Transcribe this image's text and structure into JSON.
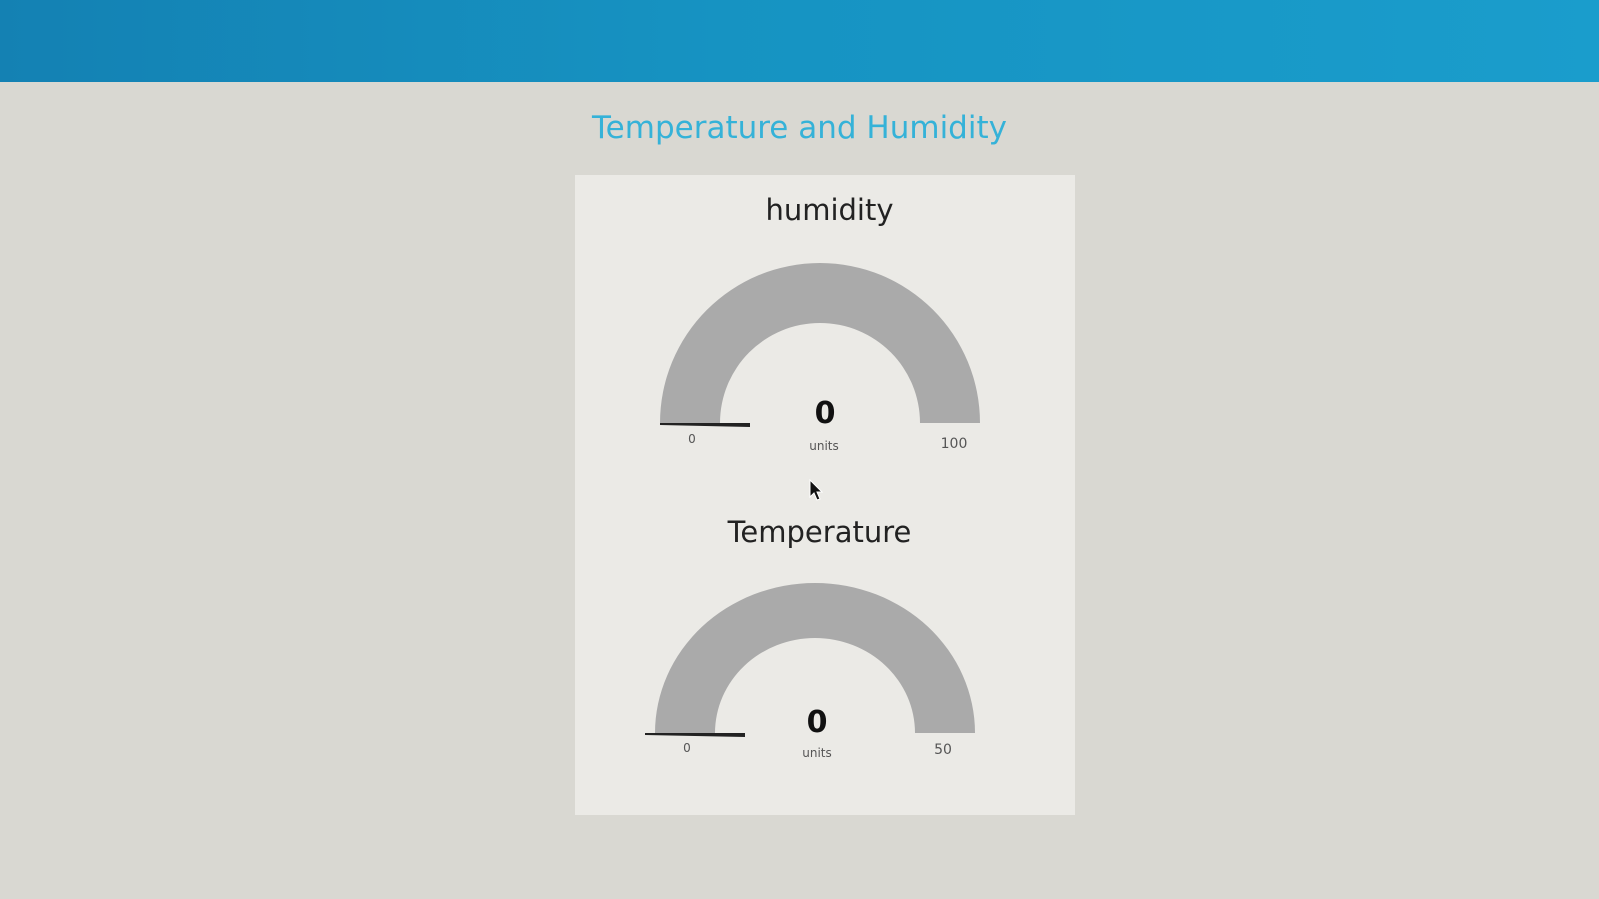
{
  "page": {
    "title": "Temperature and Humidity"
  },
  "colors": {
    "header": "#1693c2",
    "title": "#35b2d8",
    "gauge_track": "#aaaaaa",
    "gauge_fill": "#222222"
  },
  "gauges": [
    {
      "name": "humidity",
      "title": "humidity",
      "value": 0,
      "value_text": "0",
      "unit": "units",
      "min": 0,
      "min_text": "0",
      "max": 100,
      "max_text": "100"
    },
    {
      "name": "temperature",
      "title": "Temperature",
      "value": 0,
      "value_text": "0",
      "unit": "units",
      "min": 0,
      "min_text": "0",
      "max": 50,
      "max_text": "50"
    }
  ]
}
